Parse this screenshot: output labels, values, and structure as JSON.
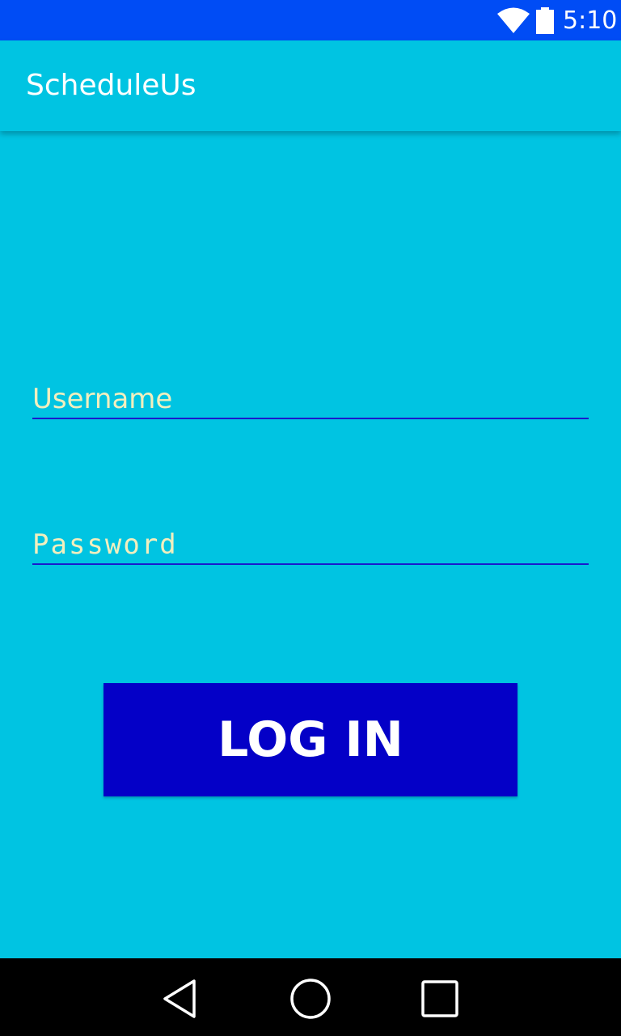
{
  "status_bar": {
    "time": "5:10",
    "icons": [
      "wifi-icon",
      "battery-icon"
    ]
  },
  "app_bar": {
    "title": "ScheduleUs"
  },
  "login_form": {
    "username_placeholder": "Username",
    "username_value": "",
    "password_placeholder": "Password",
    "password_value": "",
    "login_label": "LOG IN"
  },
  "nav_bar": {
    "icons": [
      "back-icon",
      "home-icon",
      "recents-icon"
    ]
  },
  "colors": {
    "status_bar": "#004cf5",
    "background": "#00c4e2",
    "button": "#0400c7",
    "placeholder": "#f2efbe",
    "field_underline": "#1a1acd"
  }
}
